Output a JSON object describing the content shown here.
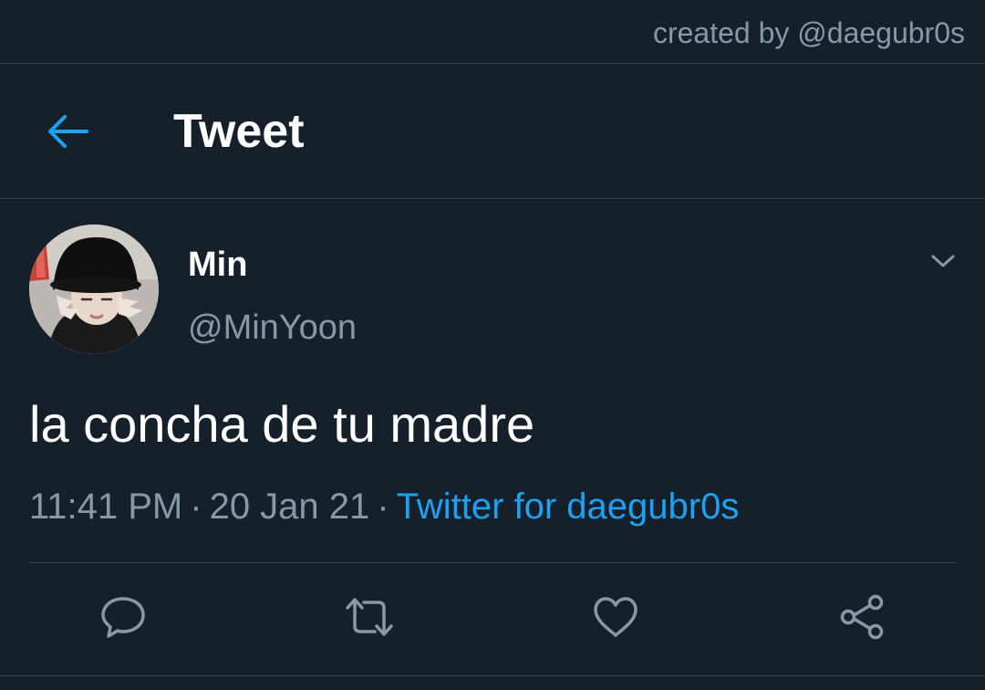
{
  "watermark": "created by @daegubr0s",
  "header": {
    "back_icon": "arrow-left-icon",
    "title": "Tweet"
  },
  "tweet": {
    "author": {
      "display_name": "Min",
      "handle": "@MinYoon",
      "avatar": "user-avatar"
    },
    "text": "la concha de tu madre",
    "time": "11:41 PM",
    "separator": "·",
    "date": "20 Jan 21",
    "source": "Twitter for daegubr0s"
  },
  "actions": [
    "reply-icon",
    "retweet-icon",
    "like-icon",
    "share-icon"
  ],
  "colors": {
    "background": "#15202b",
    "divider": "#38444d",
    "text_primary": "#ffffff",
    "text_secondary": "#8899a6",
    "accent": "#1da1f2"
  }
}
